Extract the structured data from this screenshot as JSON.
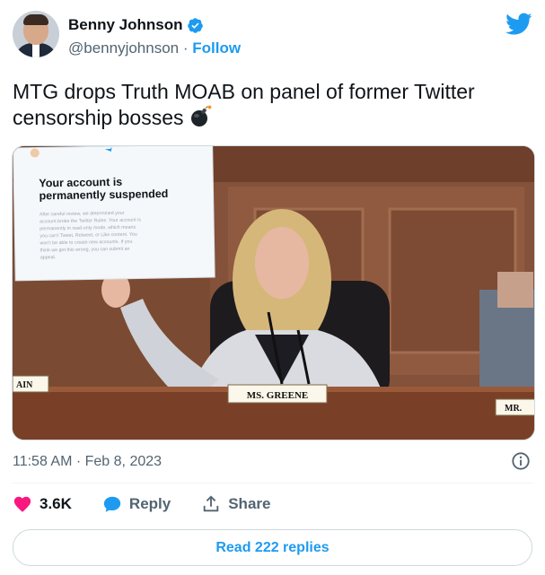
{
  "author": {
    "display_name": "Benny Johnson",
    "handle": "@bennyjohnson",
    "separator": "·",
    "follow_label": "Follow"
  },
  "tweet": {
    "text": "MTG drops Truth MOAB on panel of former Twitter censorship bosses",
    "emoji": "bomb-emoji"
  },
  "media": {
    "sign": {
      "title_line1": "Your account is",
      "title_line2": "permanently suspended",
      "body_lines": [
        "After careful review, we determined your",
        "account broke the Twitter Rules. Your account is",
        "permanently in read-only mode, which means",
        "you can't Tweet, Retweet, or Like content. You",
        "won't be able to create new accounts. If you",
        "think we got this wrong, you can submit an",
        "appeal."
      ]
    },
    "placards": {
      "center": "MS. GREENE",
      "left": "AIN",
      "right": "MR."
    }
  },
  "meta": {
    "timestamp": "11:58 AM · Feb 8, 2023"
  },
  "actions": {
    "like_count": "3.6K",
    "reply_label": "Reply",
    "share_label": "Share"
  },
  "footer": {
    "read_replies_label": "Read 222 replies"
  },
  "colors": {
    "accent": "#1d9bf0",
    "like": "#f91880",
    "secondary_text": "#536471"
  },
  "icons": [
    "verified-badge-icon",
    "twitter-bird-icon",
    "info-icon",
    "heart-icon",
    "reply-bubble-icon",
    "share-icon",
    "bomb-emoji-icon"
  ]
}
